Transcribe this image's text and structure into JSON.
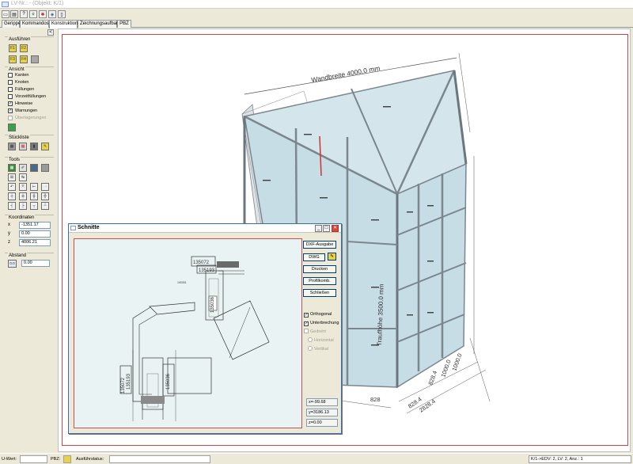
{
  "window": {
    "title": "LV-Nr.:  - (Objekt: K/1)"
  },
  "tabs": [
    {
      "label": "Gerippe"
    },
    {
      "label": "Kommandos"
    },
    {
      "label": "Konstruktion"
    },
    {
      "label": "Zeichnungsaufbau"
    },
    {
      "label": "PBZ"
    }
  ],
  "leftpanel": {
    "collapse": "<",
    "ausfuehren": {
      "label": "Ausführen"
    },
    "ansicht": {
      "label": "Ansicht",
      "items": [
        {
          "label": "Kanten",
          "checked": false
        },
        {
          "label": "Knoten",
          "checked": false
        },
        {
          "label": "Füllungen",
          "checked": false
        },
        {
          "label": "Vorzeitfüllungen",
          "checked": false
        },
        {
          "label": "Hinweise",
          "checked": true
        },
        {
          "label": "Warnungen",
          "checked": true
        },
        {
          "label": "Überlagerungen",
          "checked": false,
          "disabled": true
        }
      ]
    },
    "stueckliste": {
      "label": "Stückliste"
    },
    "tools": {
      "label": "Tools"
    },
    "koordinaten": {
      "label": "Koordinaten",
      "x_label": "x",
      "x": "-1351.17",
      "y_label": "y",
      "y": "0.00",
      "z_label": "z",
      "z": "4006.21"
    },
    "abstand": {
      "label": "Abstand",
      "button": "0.0",
      "value": "0.00"
    }
  },
  "model": {
    "dim_top": "Wandbreite 4000.0 mm",
    "dim_height": "Traufhöhe 3500.0 mm",
    "dim_bottom1": "828.4",
    "dim_bottom2": "2828.4",
    "dim_r1": "828.4",
    "dim_r2": "1000.0",
    "dim_r3": "1000.0",
    "dim_partial": "828"
  },
  "dialog": {
    "title": "Schnitte",
    "buttons": {
      "dxf": "DXF-Ausgabe",
      "dwg": "DWG",
      "print": "Drucken",
      "profile": "Profilkomb.",
      "close": "Schließen"
    },
    "orthogonal": {
      "label": "Orthogonal",
      "checked": true
    },
    "unterbrechung": {
      "label": "Unterbrechung",
      "checked": true
    },
    "gedreht": {
      "label": "Gedreht",
      "checked": false
    },
    "horizontal": {
      "label": "Horizontal"
    },
    "vertikal": {
      "label": "Vertikal"
    },
    "x": "x=-99.68",
    "y": "y=3186.13",
    "z": "z=0.00",
    "drawing": {
      "label1": "135072",
      "label2": "135193",
      "label3": "135036",
      "label4": "135072",
      "label5": "135193",
      "label6": "135036",
      "small": "190301"
    }
  },
  "status": {
    "uwert_label": "U-Wert:",
    "pbz_label": "PBZ:",
    "ausfuehr_label": "Ausführstatus:",
    "right": "K/1->EDV: 2, LV: 2, Anz.: 1"
  },
  "colors": {
    "glass": "#c6dde6",
    "frame": "#8c9aa4",
    "accent": "#cc3333"
  }
}
